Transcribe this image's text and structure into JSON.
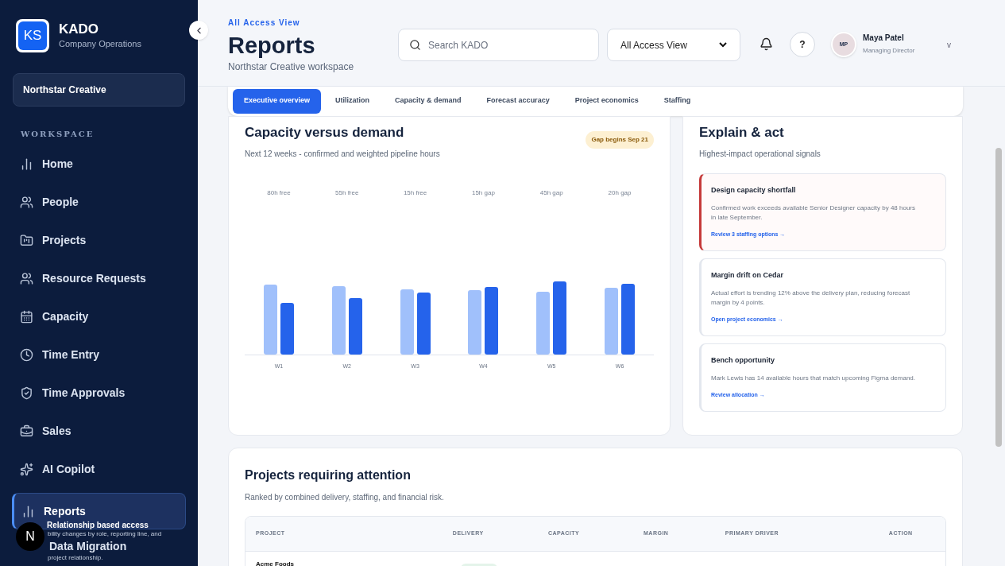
{
  "sidebar": {
    "brand": {
      "logo": "KS",
      "name": "KADO",
      "subtitle": "Company Operations"
    },
    "workspace_switcher": "Northstar Creative",
    "section_label": "WORKSPACE",
    "items": [
      {
        "label": "Home",
        "selected": false
      },
      {
        "label": "People",
        "selected": false
      },
      {
        "label": "Projects",
        "selected": false
      },
      {
        "label": "Resource Requests",
        "selected": false
      },
      {
        "label": "Capacity",
        "selected": false
      },
      {
        "label": "Time Entry",
        "selected": false
      },
      {
        "label": "Time Approvals",
        "selected": false
      },
      {
        "label": "Sales",
        "selected": false
      },
      {
        "label": "AI Copilot",
        "selected": false
      },
      {
        "label": "Reports",
        "selected": true
      },
      {
        "label": "Data Migration",
        "selected": false
      }
    ],
    "tooltip": {
      "title": "Relationship based access",
      "text": "bility changes by role, reporting line, and",
      "text_2": "project relationship."
    },
    "dev_badge": "N"
  },
  "header": {
    "eyebrow": "All Access View",
    "title": "Reports",
    "subtitle": "Northstar Creative workspace",
    "search": {
      "placeholder": "Search KADO"
    },
    "view_select": "All Access View",
    "help": "?",
    "user": {
      "initials": "MP",
      "name": "Maya Patel",
      "role": "Managing Director",
      "caret": "v"
    }
  },
  "tabs": [
    {
      "label": "Executive overview",
      "selected": true
    },
    {
      "label": "Utilization",
      "selected": false
    },
    {
      "label": "Capacity & demand",
      "selected": false
    },
    {
      "label": "Forecast accuracy",
      "selected": false
    },
    {
      "label": "Project economics",
      "selected": false
    },
    {
      "label": "Staffing",
      "selected": false
    }
  ],
  "capacity_card": {
    "title": "Capacity versus demand",
    "subtitle": "Next 12 weeks - confirmed and weighted pipeline hours",
    "badge": "Gap begins Sep 21",
    "weeks": [
      {
        "label": "W1",
        "note": "80h free"
      },
      {
        "label": "W2",
        "note": "55h free"
      },
      {
        "label": "W3",
        "note": "15h free"
      },
      {
        "label": "W4",
        "note": "15h gap"
      },
      {
        "label": "W5",
        "note": "45h gap"
      },
      {
        "label": "W6",
        "note": "20h gap"
      }
    ]
  },
  "explain_card": {
    "title": "Explain & act",
    "subtitle": "Highest-impact operational signals",
    "signals": [
      {
        "title": "Design capacity shortfall",
        "text": "Confirmed work exceeds available Senior Designer capacity by 48 hours in late September.",
        "action": "Review 3 staffing options →",
        "highlighted": true
      },
      {
        "title": "Margin drift on Cedar",
        "text": "Actual effort is trending 12% above the delivery plan, reducing forecast margin by 4 points.",
        "action": "Open project economics →",
        "highlighted": false
      },
      {
        "title": "Bench opportunity",
        "text": "Mark Lewis has 14 available hours that match upcoming Figma demand.",
        "action": "Review allocation →",
        "highlighted": false
      }
    ]
  },
  "projects_card": {
    "title": "Projects requiring attention",
    "subtitle": "Ranked by combined delivery, staffing, and financial risk.",
    "columns": [
      "PROJECT",
      "DELIVERY",
      "CAPACITY",
      "MARGIN",
      "PRIMARY DRIVER",
      "ACTION"
    ],
    "rows": [
      {
        "project": "Acme Foods"
      }
    ]
  }
}
